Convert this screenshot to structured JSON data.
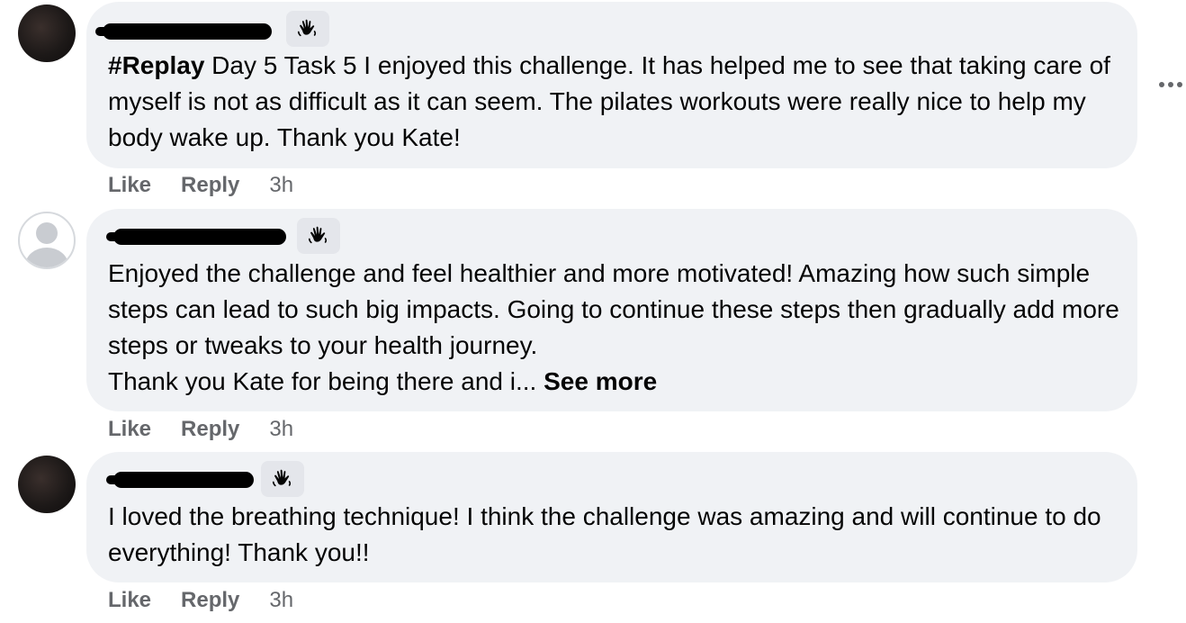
{
  "comments": [
    {
      "hashtag": "#Replay",
      "text": " Day 5 Task 5 I enjoyed this challenge. It has helped me to see that taking care of myself is not as difficult as it can seem. The pilates workouts were really nice to help my body wake up. Thank you Kate!",
      "like_label": "Like",
      "reply_label": "Reply",
      "time": "3h",
      "badge_icon": "waving-hand-icon"
    },
    {
      "text": "Enjoyed the challenge and feel healthier and more motivated! Amazing how such simple steps can lead to such big impacts. Going to continue these steps then gradually add more steps or tweaks to your health journey.\nThank you Kate for being there and i... ",
      "see_more": "See more",
      "like_label": "Like",
      "reply_label": "Reply",
      "time": "3h",
      "badge_icon": "waving-hand-icon"
    },
    {
      "text": "I loved the breathing technique! I think the challenge was amazing and will continue to do everything! Thank you!!",
      "like_label": "Like",
      "reply_label": "Reply",
      "time": "3h",
      "badge_icon": "waving-hand-icon"
    }
  ],
  "colors": {
    "bubble": "#f0f2f5",
    "badge": "#e4e6eb",
    "secondary_text": "#65676b",
    "primary_text": "#050505"
  }
}
